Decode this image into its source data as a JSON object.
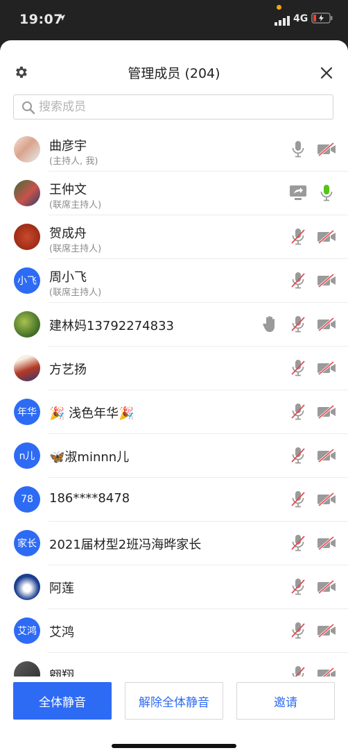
{
  "status_bar": {
    "time": "19:07",
    "network": "4G"
  },
  "header": {
    "title": "管理成员 (204)"
  },
  "search": {
    "placeholder": "搜索成员"
  },
  "participants": [
    {
      "name": "曲彦宇",
      "role": "(主持人, 我)",
      "avatar": "photo",
      "hand": false,
      "share": false,
      "mic": "on-gray",
      "camera": "off"
    },
    {
      "name": "王仲文",
      "role": "(联席主持人)",
      "avatar": "photo",
      "hand": false,
      "share": true,
      "mic": "on-green",
      "camera": "none"
    },
    {
      "name": "贺成舟",
      "role": "(联席主持人)",
      "avatar": "photo",
      "hand": false,
      "share": false,
      "mic": "off",
      "camera": "off"
    },
    {
      "name": "周小飞",
      "role": "(联席主持人)",
      "avatar": "小飞",
      "hand": false,
      "share": false,
      "mic": "off",
      "camera": "off"
    },
    {
      "name": "建林妈13792274833",
      "role": "",
      "avatar": "photo",
      "hand": true,
      "share": false,
      "mic": "off",
      "camera": "off"
    },
    {
      "name": " 方艺扬",
      "role": "",
      "avatar": "photo",
      "hand": false,
      "share": false,
      "mic": "off",
      "camera": "off"
    },
    {
      "name": "🎉 浅色年华🎉",
      "role": "",
      "avatar": "年华",
      "hand": false,
      "share": false,
      "mic": "off",
      "camera": "off"
    },
    {
      "name": "🦋淑minnn儿",
      "role": "",
      "avatar": "n儿",
      "hand": false,
      "share": false,
      "mic": "off",
      "camera": "off"
    },
    {
      "name": "186****8478",
      "role": "",
      "avatar": "78",
      "hand": false,
      "share": false,
      "mic": "off",
      "camera": "off"
    },
    {
      "name": "2021届材型2班冯海晔家长",
      "role": "",
      "avatar": "家长",
      "hand": false,
      "share": false,
      "mic": "off",
      "camera": "off"
    },
    {
      "name": "阿莲",
      "role": "",
      "avatar": "photo",
      "hand": false,
      "share": false,
      "mic": "off",
      "camera": "off"
    },
    {
      "name": "艾鸿",
      "role": "",
      "avatar": "艾鸿",
      "hand": false,
      "share": false,
      "mic": "off",
      "camera": "off"
    },
    {
      "name": "翱翔",
      "role": "",
      "avatar": "photo",
      "hand": false,
      "share": false,
      "mic": "off",
      "camera": "off"
    }
  ],
  "buttons": {
    "mute_all": "全体静音",
    "unmute_all": "解除全体静音",
    "invite": "邀请"
  },
  "colors": {
    "accent": "#2e6bf4",
    "mic_on_green": "#52c41a",
    "muted_red": "#e5484d",
    "icon_gray": "#9a9a9a"
  }
}
